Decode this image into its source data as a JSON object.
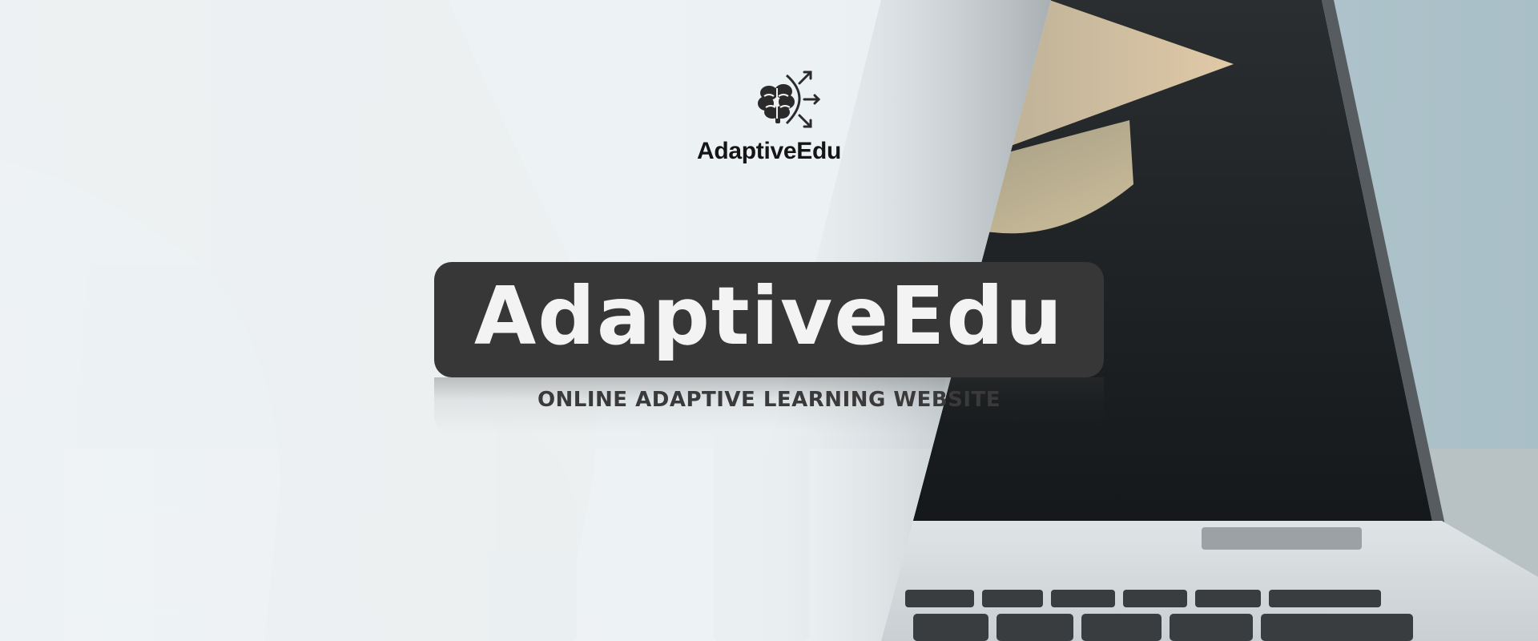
{
  "brand": {
    "logo_name": "AdaptiveEdu",
    "logo_icon": "brain-with-arrows-icon"
  },
  "hero": {
    "title": "AdaptiveEdu",
    "subtitle": "ONLINE ADAPTIVE LEARNING WEBSITE"
  },
  "colors": {
    "title_box": "#373737",
    "title_text": "#f3f3f4",
    "subtitle_text": "#3a3a3a",
    "wordmark_text": "#151515"
  }
}
